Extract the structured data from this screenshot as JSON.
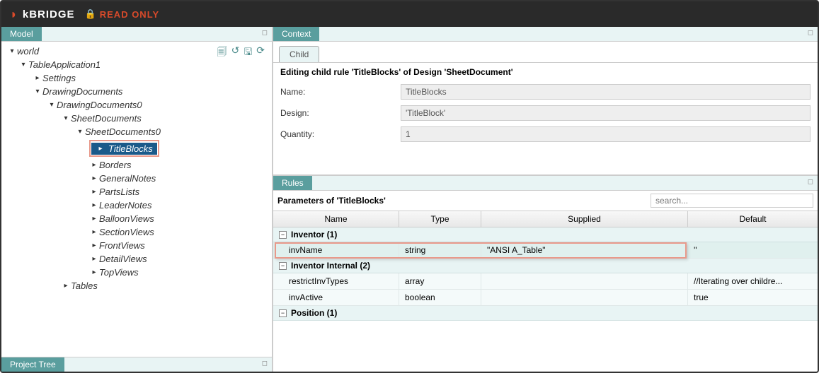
{
  "header": {
    "brand": "kBRIDGE",
    "readonly": "READ ONLY"
  },
  "panels": {
    "model": "Model",
    "project_tree": "Project Tree",
    "context": "Context",
    "rules": "Rules",
    "child_tab": "Child"
  },
  "tree": {
    "root": "world",
    "n1": "TableApplication1",
    "n2": "Settings",
    "n3": "DrawingDocuments",
    "n4": "DrawingDocuments0",
    "n5": "SheetDocuments",
    "n6": "SheetDocuments0",
    "n7": "TitleBlocks",
    "n8": "Borders",
    "n9": "GeneralNotes",
    "n10": "PartsLists",
    "n11": "LeaderNotes",
    "n12": "BalloonViews",
    "n13": "SectionViews",
    "n14": "FrontViews",
    "n15": "DetailViews",
    "n16": "TopViews",
    "n17": "Tables"
  },
  "context": {
    "editing": "Editing child rule 'TitleBlocks' of Design 'SheetDocument'",
    "name_label": "Name:",
    "name_value": "TitleBlocks",
    "design_label": "Design:",
    "design_value": "'TitleBlock'",
    "quantity_label": "Quantity:",
    "quantity_value": "1"
  },
  "rules": {
    "params_title": "Parameters of 'TitleBlocks'",
    "search_placeholder": "search...",
    "cols": {
      "name": "Name",
      "type": "Type",
      "supplied": "Supplied",
      "default": "Default"
    },
    "group1": "Inventor (1)",
    "row1": {
      "name": "invName",
      "type": "string",
      "supplied": "\"ANSI A_Table\"",
      "default": "''"
    },
    "group2": "Inventor Internal (2)",
    "row2": {
      "name": "restrictInvTypes",
      "type": "array",
      "supplied": "",
      "default": "//Iterating over childre..."
    },
    "row3": {
      "name": "invActive",
      "type": "boolean",
      "supplied": "",
      "default": "true"
    },
    "group3": "Position (1)"
  }
}
